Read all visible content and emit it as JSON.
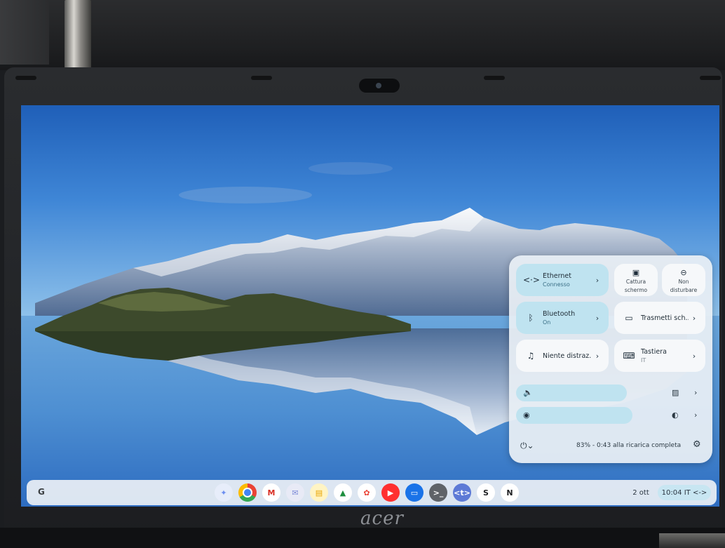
{
  "colors": {
    "accent_tile": "#bfe3f0",
    "panel_bg": "#e8eef4",
    "shelf_bg": "#ecf0f5"
  },
  "quick_settings": {
    "ethernet": {
      "title": "Ethernet",
      "status": "Connesso",
      "icon": "ethernet-icon"
    },
    "screen_capture": {
      "label_line1": "Cattura",
      "label_line2": "schermo",
      "icon": "screen-capture-icon"
    },
    "do_not_disturb": {
      "label_line1": "Non",
      "label_line2": "disturbare",
      "icon": "do-not-disturb-icon"
    },
    "bluetooth": {
      "title": "Bluetooth",
      "status": "On",
      "icon": "bluetooth-icon"
    },
    "cast": {
      "title": "Trasmetti sch...",
      "icon": "cast-icon"
    },
    "focus": {
      "title": "Niente distraz...",
      "icon": "focus-mode-icon"
    },
    "keyboard": {
      "title": "Tastiera",
      "status": "IT",
      "icon": "keyboard-icon"
    },
    "volume": {
      "icon": "volume-icon",
      "level": 0.62
    },
    "brightness": {
      "icon": "brightness-icon",
      "level": 0.65
    },
    "battery_text": "83% - 0:43 alla ricarica completa"
  },
  "shelf": {
    "launcher_label": "G",
    "apps": [
      {
        "name": "gemini-app-icon",
        "glyph": "✦",
        "color": "#7aa0f5"
      },
      {
        "name": "chrome-app-icon",
        "glyph": "",
        "color": "#e8453c"
      },
      {
        "name": "gmail-app-icon",
        "glyph": "M",
        "color": "#ffffff"
      },
      {
        "name": "mail-app-icon",
        "glyph": "✉",
        "color": "#c5cdf4"
      },
      {
        "name": "docs-app-icon",
        "glyph": "▤",
        "color": "#f5b400"
      },
      {
        "name": "drive-app-icon",
        "glyph": "▲",
        "color": "#ffffff"
      },
      {
        "name": "photos-app-icon",
        "glyph": "✿",
        "color": "#ffffff"
      },
      {
        "name": "youtube-app-icon",
        "glyph": "▶",
        "color": "#ff0000"
      },
      {
        "name": "files-app-icon",
        "glyph": "▭",
        "color": "#1a73e8"
      },
      {
        "name": "terminal-app-icon",
        "glyph": ">_",
        "color": "#5f6368"
      },
      {
        "name": "code-app-icon",
        "glyph": "<t>",
        "color": "#5d7ad6"
      },
      {
        "name": "script-app-icon",
        "glyph": "S",
        "color": "#ffffff"
      },
      {
        "name": "notion-app-icon",
        "glyph": "N",
        "color": "#ffffff"
      }
    ],
    "date": "2 ott",
    "time": "10:04",
    "input_lang": "IT",
    "network_glyph": "<->"
  },
  "laptop_brand": "acer"
}
